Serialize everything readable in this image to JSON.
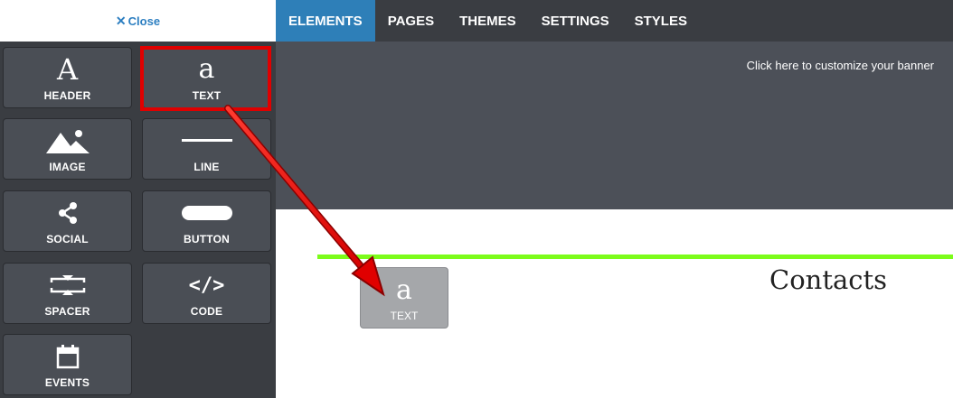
{
  "close_button": {
    "icon": "close-icon",
    "label": "Close"
  },
  "nav": {
    "tabs": [
      {
        "label": "ELEMENTS",
        "active": true
      },
      {
        "label": "PAGES",
        "active": false
      },
      {
        "label": "THEMES",
        "active": false
      },
      {
        "label": "SETTINGS",
        "active": false
      },
      {
        "label": "STYLES",
        "active": false
      }
    ]
  },
  "elements": [
    {
      "label": "HEADER",
      "icon": "header-a-icon",
      "glyph": "A"
    },
    {
      "label": "TEXT",
      "icon": "text-a-icon",
      "glyph": "a"
    },
    {
      "label": "IMAGE",
      "icon": "image-icon"
    },
    {
      "label": "LINE",
      "icon": "line-icon"
    },
    {
      "label": "SOCIAL",
      "icon": "share-icon"
    },
    {
      "label": "BUTTON",
      "icon": "button-icon"
    },
    {
      "label": "SPACER",
      "icon": "spacer-icon"
    },
    {
      "label": "CODE",
      "icon": "code-icon",
      "glyph": "</>"
    },
    {
      "label": "EVENTS",
      "icon": "calendar-icon"
    }
  ],
  "banner": {
    "text": "Click here to customize your banner"
  },
  "content": {
    "heading": "Contacts"
  },
  "drag_preview": {
    "label": "TEXT",
    "glyph": "a"
  },
  "colors": {
    "accent": "#2e7fb8",
    "panel": "#3a3d42",
    "tile": "#4a4e55",
    "banner": "#4c5058",
    "highlight": "#e00000",
    "divider": "#7cfc1a"
  }
}
